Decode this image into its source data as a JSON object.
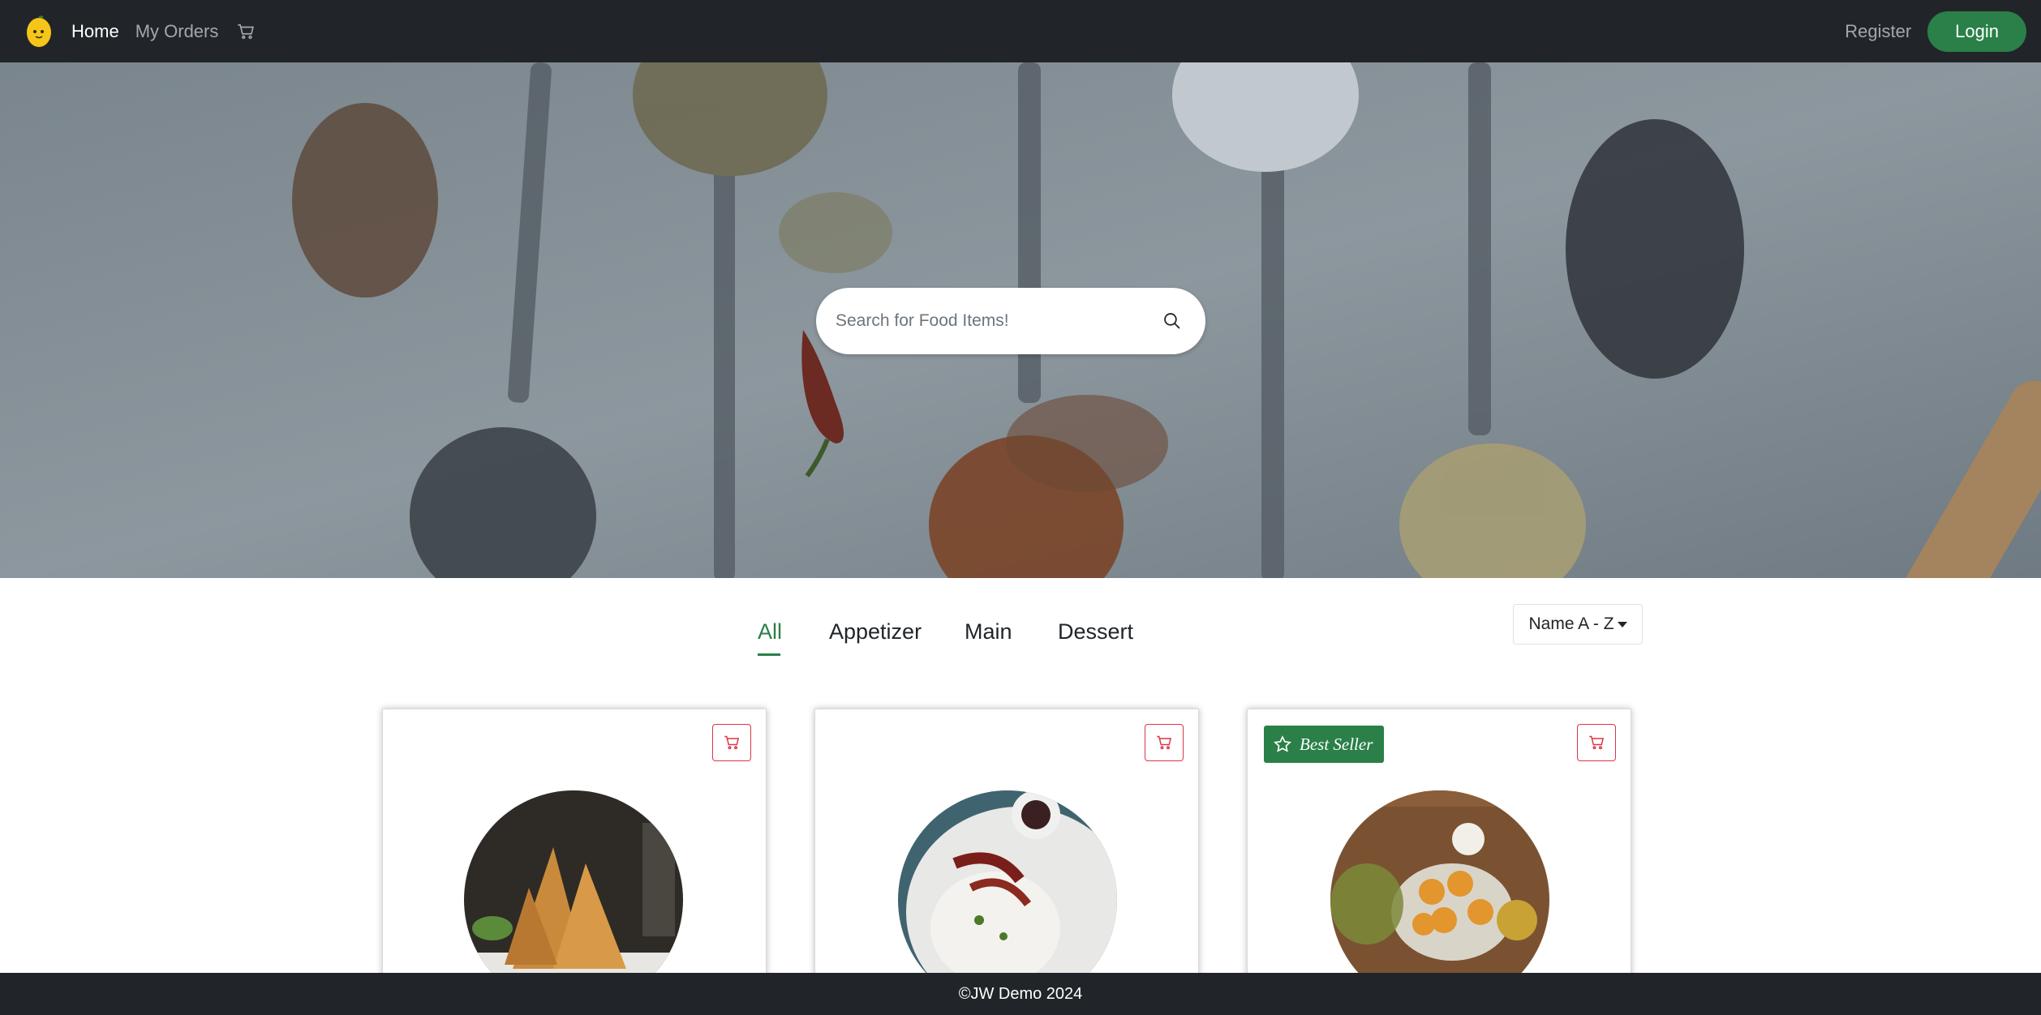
{
  "nav": {
    "logo_icon": "lemon-logo-icon",
    "home": "Home",
    "my_orders": "My Orders",
    "cart_icon": "cart-icon",
    "register": "Register",
    "login": "Login"
  },
  "hero": {
    "search_placeholder": "Search for Food Items!",
    "search_icon": "search-icon"
  },
  "tabs": [
    "All",
    "Appetizer",
    "Main",
    "Dessert"
  ],
  "active_tab": "All",
  "sort": {
    "selected": "Name A - Z"
  },
  "cards": [
    {
      "badge": "",
      "image": "samosa"
    },
    {
      "badge": "",
      "image": "dish-with-chili"
    },
    {
      "badge": "Best Seller",
      "image": "sweets-platter"
    }
  ],
  "footer": {
    "text": "©JW Demo 2024"
  },
  "colors": {
    "navbar": "#212529",
    "accent": "#2a8048",
    "cart_border": "#dc3545"
  }
}
